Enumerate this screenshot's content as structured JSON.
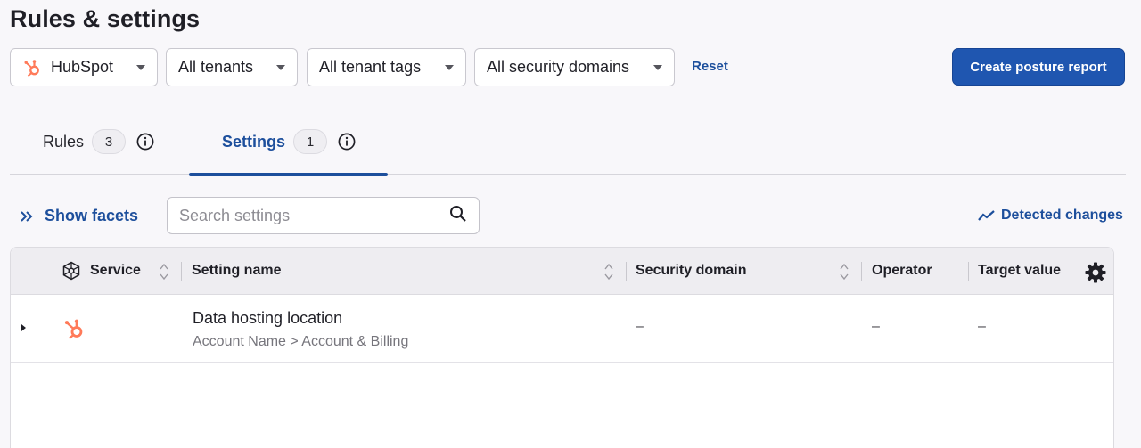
{
  "page": {
    "title": "Rules & settings"
  },
  "filters": {
    "service": "HubSpot",
    "tenants": "All tenants",
    "tenant_tags": "All tenant tags",
    "security_domains": "All security domains",
    "reset_label": "Reset"
  },
  "actions": {
    "create_report_label": "Create posture report"
  },
  "tabs": [
    {
      "label": "Rules",
      "count": "3",
      "active": false
    },
    {
      "label": "Settings",
      "count": "1",
      "active": true
    }
  ],
  "toolbar": {
    "show_facets_label": "Show facets",
    "search_placeholder": "Search settings",
    "detected_changes_label": "Detected changes"
  },
  "table": {
    "columns": [
      "Service",
      "Setting name",
      "Security domain",
      "Operator",
      "Target value"
    ],
    "rows": [
      {
        "service_icon": "hubspot-logo",
        "setting_name": "Data hosting location",
        "setting_path": "Account Name > Account & Billing",
        "security_domain": "–",
        "operator": "–",
        "target_value": "–"
      }
    ]
  },
  "colors": {
    "accent": "#1d4f9c",
    "primary_button": "#1f56b0",
    "hubspot_orange": "#ff7a59",
    "background": "#f8f7fa"
  },
  "icons": [
    "hubspot-icon",
    "chevron-down-icon",
    "info-icon",
    "double-chevron-right-icon",
    "search-icon",
    "trend-line-icon",
    "service-network-icon",
    "sort-icon",
    "gear-icon",
    "expand-caret-icon"
  ]
}
